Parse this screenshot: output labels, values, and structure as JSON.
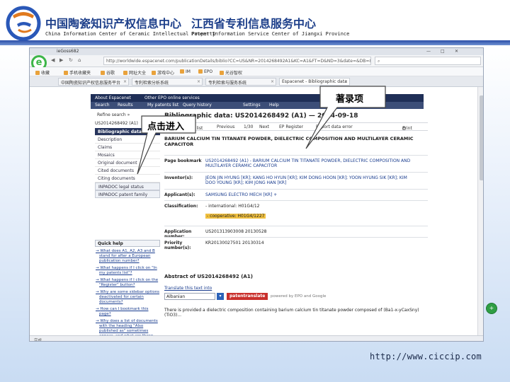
{
  "slide": {
    "title_left": "中国陶瓷知识产权信息中心",
    "title_right": "江西省专利信息服务中心",
    "subtitle_left": "China Information Center of Ceramic Intellectual Property",
    "subtitle_right": "Patent Information Service Center of Jiangxi Province",
    "footer_url": "http://www.ciccip.com"
  },
  "browser": {
    "window_title": "ieGoss682",
    "url": "http://worldwide.espacenet.com/publicationDetails/biblio?CC=US&NR=2014268492A1&KC=A1&FT=D&ND=3&date=&DB=&locale=en_EP",
    "bookmarks": [
      "收藏",
      "手机收藏夹",
      "谷歌",
      "网址大全",
      "游戏中心",
      "IM",
      "EPO",
      "光谷智权"
    ],
    "tabs": [
      "中国陶瓷知识产权信息服务平台",
      "专利检索分析系统",
      "专利检索与服务系统",
      "Espacenet - Bibliographic data"
    ],
    "status_text": "完成"
  },
  "espacenet": {
    "topnav": [
      "About Espacenet",
      "Other EPO online services"
    ],
    "menu": [
      "Search",
      "Results",
      "My patents list",
      "Query history",
      "Settings",
      "Help"
    ],
    "refine_search": "Refine search »",
    "sidebar_head": "US2014268492 (A1)",
    "sidebar": [
      "Bibliographic data",
      "Description",
      "Claims",
      "Mosaics",
      "Original document",
      "Cited documents",
      "Citing documents",
      "INPADOC legal status",
      "INPADOC patent family"
    ],
    "quick_help_title": "Quick help",
    "quick_help": [
      "What does A1, A2, A3 and B stand for after a European publication number?",
      "What happens if I click on \"In my patents list\"?",
      "What happens if I click on the \"Register\" button?",
      "Why are some sidebar options deactivated for certain documents?",
      "How can I bookmark this page?",
      "Why does a list of documents with the heading \"Also published as\" sometimes appear, and what are these documents?"
    ],
    "bib_title": "Bibliographic data: US2014268492 (A1) — 2014-09-18",
    "toolbar": {
      "my_patents": "In my patents list",
      "previous": "Previous",
      "count": "1/30",
      "next": "Next",
      "register": "EP Register",
      "report": "Report data error",
      "print": "Print"
    },
    "doc_title": "BARIUM CALCIUM TIN TITANATE POWDER, DIELECTRIC COMPOSITION AND MULTILAYER CERAMIC CAPACITOR",
    "fields": {
      "bookmark_label": "Page bookmark",
      "bookmark_value": "US2014268492 (A1) - BARIUM CALCIUM TIN TITANATE POWDER, DIELECTRIC COMPOSITION AND MULTILAYER CERAMIC CAPACITOR",
      "inventor_label": "Inventor(s):",
      "inventor_value": "JEON JIN HYUNG [KR]; KANG HO HYUN [KR]; KIM DONG HOON [KR]; YOON HYUNG SIK [KR]; KIM DOO YOUNG [KR]; KIM JONG HAN [KR]",
      "applicant_label": "Applicant(s):",
      "applicant_value": "SAMSUNG ELECTRO MECH [KR] +",
      "classification_label": "Classification:",
      "classification_intl": "- international: H01G4/12",
      "classification_coop": "- cooperative: H01G4/1227",
      "appno_label": "Application number:",
      "appno_value": "US201313903008 20130528",
      "priority_label": "Priority number(s):",
      "priority_value": "KR20130027501 20130314"
    },
    "abstract_title": "Abstract of US2014268492 (A1)",
    "translate_label": "Translate this text into",
    "language": "Albanian",
    "lang_button": "▾",
    "patenttranslate": "patentranslate",
    "patenttranslate_note": "powered by EPO and Google",
    "abstract_text": "There is provided a dielectric composition containing barium calcium tin titanate powder composed of (Ba1-x-yCaxSny)(TiO3)..."
  },
  "callouts": {
    "entry": "点击进入",
    "bib_item": "著录项"
  }
}
